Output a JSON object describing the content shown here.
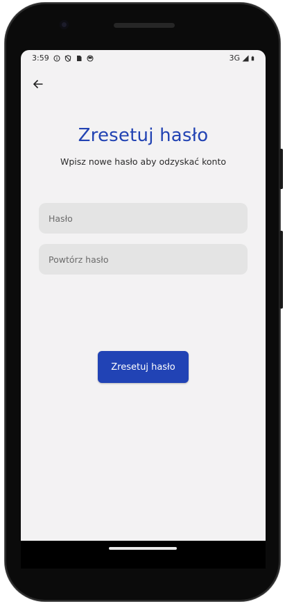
{
  "status_bar": {
    "time": "3:59",
    "network": "3G",
    "left_icons": [
      "info-icon",
      "shield-icon",
      "sim-icon",
      "sync-icon"
    ],
    "right_icons": [
      "signal-icon",
      "battery-icon"
    ]
  },
  "header": {
    "back_icon": "arrow-left-icon"
  },
  "page": {
    "title": "Zresetuj hasło",
    "subtitle": "Wpisz nowe hasło aby odzyskać konto"
  },
  "form": {
    "password_placeholder": "Hasło",
    "password_value": "",
    "repeat_placeholder": "Powtórz hasło",
    "repeat_value": "",
    "submit_label": "Zresetuj hasło"
  },
  "colors": {
    "accent": "#2243b3",
    "background": "#f3f2f3",
    "field_background": "#e4e4e4"
  }
}
